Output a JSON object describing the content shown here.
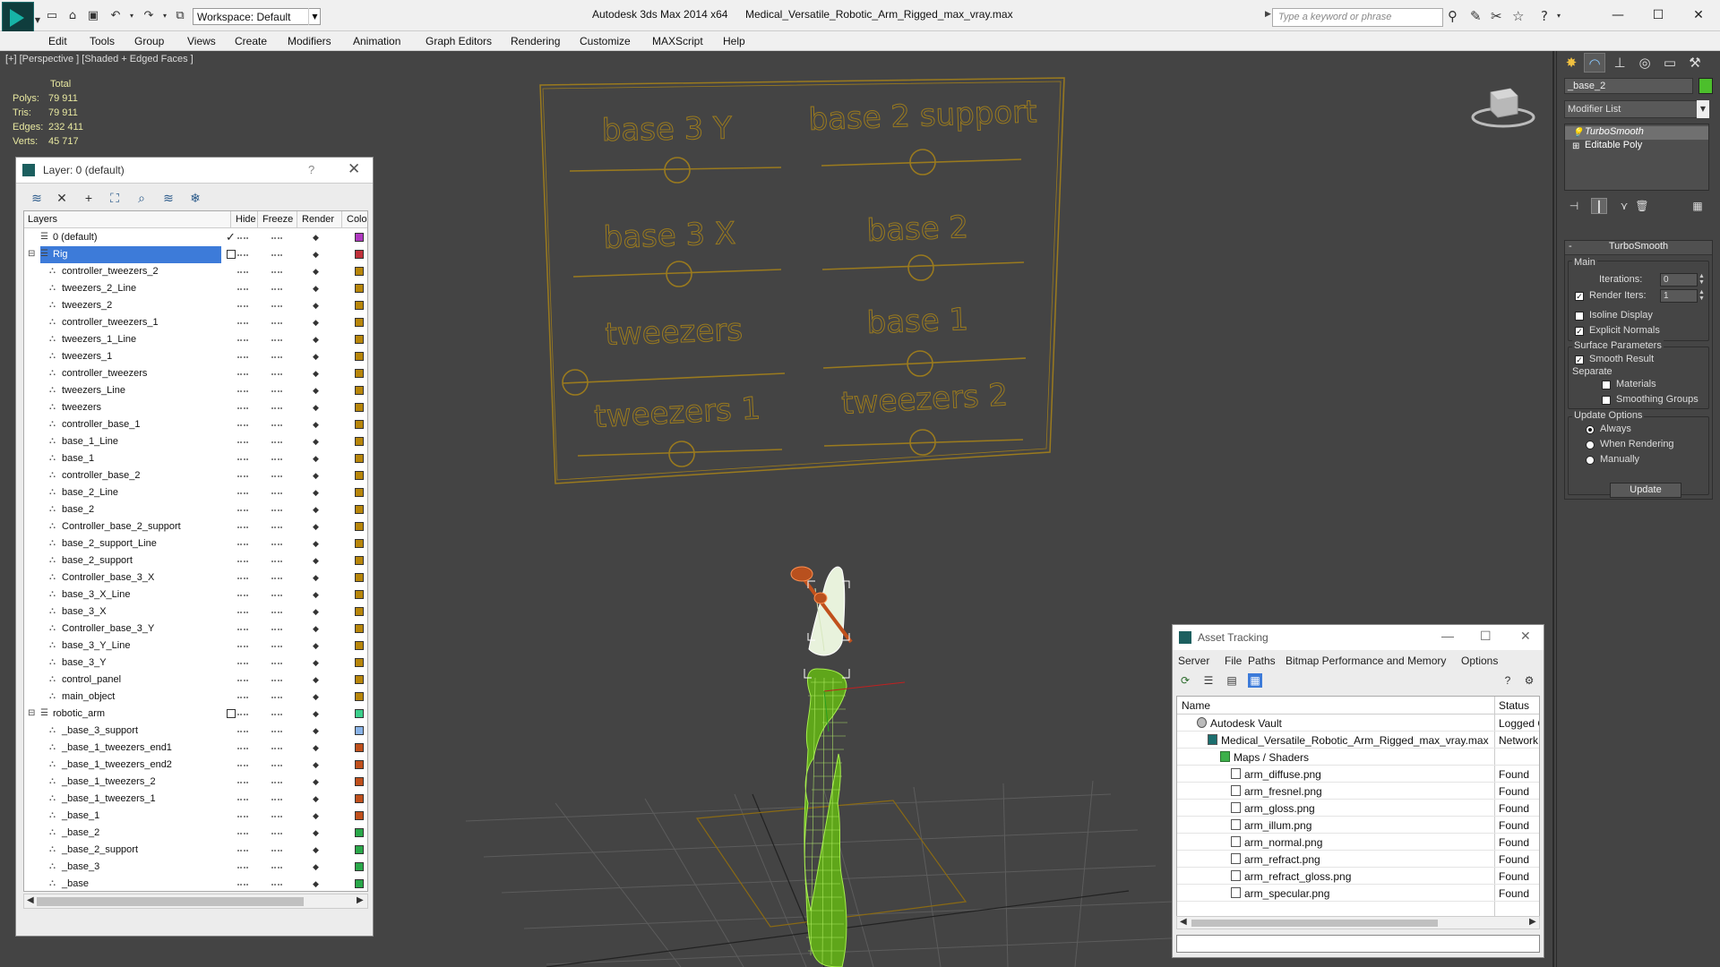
{
  "titlebar": {
    "workspace": "Workspace: Default",
    "app_name": "Autodesk 3ds Max  2014 x64",
    "file_name": "Medical_Versatile_Robotic_Arm_Rigged_max_vray.max",
    "search_placeholder": "Type a keyword or phrase",
    "icons": [
      "new-icon",
      "open-icon",
      "save-icon",
      "undo-icon",
      "redo-icon",
      "project-icon",
      "binoculars-icon",
      "exchange-icon",
      "favorites-icon",
      "help-icon"
    ]
  },
  "menu": [
    "Edit",
    "Tools",
    "Group",
    "Views",
    "Create",
    "Modifiers",
    "Animation",
    "Graph Editors",
    "Rendering",
    "Customize",
    "MAXScript",
    "Help"
  ],
  "viewport": {
    "label": "[+] [Perspective ] [Shaded + Edged Faces ]",
    "stats": {
      "header": "Total",
      "rows": [
        {
          "label": "Polys:",
          "value": "79 911"
        },
        {
          "label": "Tris:",
          "value": "79 911"
        },
        {
          "label": "Edges:",
          "value": "232 411"
        },
        {
          "label": "Verts:",
          "value": "45 717"
        }
      ]
    },
    "control_panel_labels": [
      "base 3 Y",
      "base 2 support",
      "base 3 X",
      "base 2",
      "tweezers",
      "base 1",
      "tweezers 1",
      "tweezers 2"
    ],
    "colors": {
      "background": "#444444",
      "panel_lines": "#9a7a1e",
      "arm_mesh": "#7ad11f",
      "grid": "#5c5c5c"
    }
  },
  "layer_dialog": {
    "title": "Layer: 0 (default)",
    "help": "?",
    "columns": [
      "Layers",
      "Hide",
      "Freeze",
      "Render",
      "Color"
    ],
    "toolbar_icons": [
      "create-layer-icon",
      "delete-layer-icon",
      "add-selection-icon",
      "select-objects-icon",
      "highlight-layer-icon",
      "hide-all-icon",
      "freeze-all-icon"
    ],
    "rows": [
      {
        "name": "0 (default)",
        "level": 0,
        "type": "layer",
        "color": "#b038c0",
        "active": true
      },
      {
        "name": "Rig",
        "level": 0,
        "type": "layer",
        "color": "#c0303a",
        "selected": true,
        "expanded": true
      },
      {
        "name": "controller_tweezers_2",
        "level": 1,
        "type": "object",
        "color": "#b8860b"
      },
      {
        "name": "tweezers_2_Line",
        "level": 1,
        "type": "object",
        "color": "#b8860b"
      },
      {
        "name": "tweezers_2",
        "level": 1,
        "type": "object",
        "color": "#b8860b"
      },
      {
        "name": "controller_tweezers_1",
        "level": 1,
        "type": "object",
        "color": "#b8860b"
      },
      {
        "name": "tweezers_1_Line",
        "level": 1,
        "type": "object",
        "color": "#b8860b"
      },
      {
        "name": "tweezers_1",
        "level": 1,
        "type": "object",
        "color": "#b8860b"
      },
      {
        "name": "controller_tweezers",
        "level": 1,
        "type": "object",
        "color": "#b8860b"
      },
      {
        "name": "tweezers_Line",
        "level": 1,
        "type": "object",
        "color": "#b8860b"
      },
      {
        "name": "tweezers",
        "level": 1,
        "type": "object",
        "color": "#b8860b"
      },
      {
        "name": "controller_base_1",
        "level": 1,
        "type": "object",
        "color": "#b8860b"
      },
      {
        "name": "base_1_Line",
        "level": 1,
        "type": "object",
        "color": "#b8860b"
      },
      {
        "name": "base_1",
        "level": 1,
        "type": "object",
        "color": "#b8860b"
      },
      {
        "name": "controller_base_2",
        "level": 1,
        "type": "object",
        "color": "#b8860b"
      },
      {
        "name": "base_2_Line",
        "level": 1,
        "type": "object",
        "color": "#b8860b"
      },
      {
        "name": "base_2",
        "level": 1,
        "type": "object",
        "color": "#b8860b"
      },
      {
        "name": "Controller_base_2_support",
        "level": 1,
        "type": "object",
        "color": "#b8860b"
      },
      {
        "name": "base_2_support_Line",
        "level": 1,
        "type": "object",
        "color": "#b8860b"
      },
      {
        "name": "base_2_support",
        "level": 1,
        "type": "object",
        "color": "#b8860b"
      },
      {
        "name": "Controller_base_3_X",
        "level": 1,
        "type": "object",
        "color": "#b8860b"
      },
      {
        "name": "base_3_X_Line",
        "level": 1,
        "type": "object",
        "color": "#b8860b"
      },
      {
        "name": "base_3_X",
        "level": 1,
        "type": "object",
        "color": "#b8860b"
      },
      {
        "name": "Controller_base_3_Y",
        "level": 1,
        "type": "object",
        "color": "#b8860b"
      },
      {
        "name": "base_3_Y_Line",
        "level": 1,
        "type": "object",
        "color": "#b8860b"
      },
      {
        "name": "base_3_Y",
        "level": 1,
        "type": "object",
        "color": "#b8860b"
      },
      {
        "name": "control_panel",
        "level": 1,
        "type": "object",
        "color": "#b8860b"
      },
      {
        "name": "main_object",
        "level": 1,
        "type": "object",
        "color": "#b8860b"
      },
      {
        "name": "robotic_arm",
        "level": 0,
        "type": "layer",
        "color": "#3ccf8c",
        "expanded": true
      },
      {
        "name": "_base_3_support",
        "level": 1,
        "type": "object",
        "color": "#8ab4e8"
      },
      {
        "name": "_base_1_tweezers_end1",
        "level": 1,
        "type": "object",
        "color": "#c0501c"
      },
      {
        "name": "_base_1_tweezers_end2",
        "level": 1,
        "type": "object",
        "color": "#c0501c"
      },
      {
        "name": "_base_1_tweezers_2",
        "level": 1,
        "type": "object",
        "color": "#c0501c"
      },
      {
        "name": "_base_1_tweezers_1",
        "level": 1,
        "type": "object",
        "color": "#c0501c"
      },
      {
        "name": "_base_1",
        "level": 1,
        "type": "object",
        "color": "#c0501c"
      },
      {
        "name": "_base_2",
        "level": 1,
        "type": "object",
        "color": "#2aa84a"
      },
      {
        "name": "_base_2_support",
        "level": 1,
        "type": "object",
        "color": "#2aa84a"
      },
      {
        "name": "_base_3",
        "level": 1,
        "type": "object",
        "color": "#2aa84a"
      },
      {
        "name": "_base",
        "level": 1,
        "type": "object",
        "color": "#2aa84a"
      }
    ]
  },
  "asset_dialog": {
    "title": "Asset Tracking",
    "menu": [
      "Server",
      "File",
      "Paths",
      "Bitmap Performance and Memory",
      "Options"
    ],
    "columns": [
      "Name",
      "Status"
    ],
    "rows": [
      {
        "name": "Autodesk Vault",
        "level": 0,
        "icon": "vault-icon",
        "status": "Logged C"
      },
      {
        "name": "Medical_Versatile_Robotic_Arm_Rigged_max_vray.max",
        "level": 1,
        "icon": "max-file-icon",
        "status": "Network"
      },
      {
        "name": "Maps / Shaders",
        "level": 2,
        "icon": "maps-icon",
        "status": ""
      },
      {
        "name": "arm_diffuse.png",
        "level": 3,
        "icon": "image-file-icon",
        "status": "Found"
      },
      {
        "name": "arm_fresnel.png",
        "level": 3,
        "icon": "image-file-icon",
        "status": "Found"
      },
      {
        "name": "arm_gloss.png",
        "level": 3,
        "icon": "image-file-icon",
        "status": "Found"
      },
      {
        "name": "arm_illum.png",
        "level": 3,
        "icon": "image-file-icon",
        "status": "Found"
      },
      {
        "name": "arm_normal.png",
        "level": 3,
        "icon": "image-file-icon",
        "status": "Found"
      },
      {
        "name": "arm_refract.png",
        "level": 3,
        "icon": "image-file-icon",
        "status": "Found"
      },
      {
        "name": "arm_refract_gloss.png",
        "level": 3,
        "icon": "image-file-icon",
        "status": "Found"
      },
      {
        "name": "arm_specular.png",
        "level": 3,
        "icon": "image-file-icon",
        "status": "Found"
      }
    ]
  },
  "command_panel": {
    "object_name": "_base_2",
    "object_color": "#4cbf2c",
    "modifier_list": "Modifier List",
    "stack": [
      "TurboSmooth",
      "Editable Poly"
    ],
    "turbosmooth": {
      "title": "TurboSmooth",
      "main_label": "Main",
      "iterations_label": "Iterations:",
      "iterations": "0",
      "render_iters_label": "Render Iters:",
      "render_iters": "1",
      "render_iters_checked": true,
      "isoline_label": "Isoline Display",
      "isoline_checked": false,
      "explicit_normals_label": "Explicit Normals",
      "explicit_normals_checked": true,
      "surface_label": "Surface Parameters",
      "smooth_result_label": "Smooth Result",
      "smooth_result_checked": true,
      "separate_label": "Separate",
      "materials_label": "Materials",
      "materials_checked": false,
      "smoothing_groups_label": "Smoothing Groups",
      "smoothing_groups_checked": false,
      "update_options_label": "Update Options",
      "options": [
        "Always",
        "When Rendering",
        "Manually"
      ],
      "selected_option": "Always",
      "update_button": "Update"
    }
  }
}
